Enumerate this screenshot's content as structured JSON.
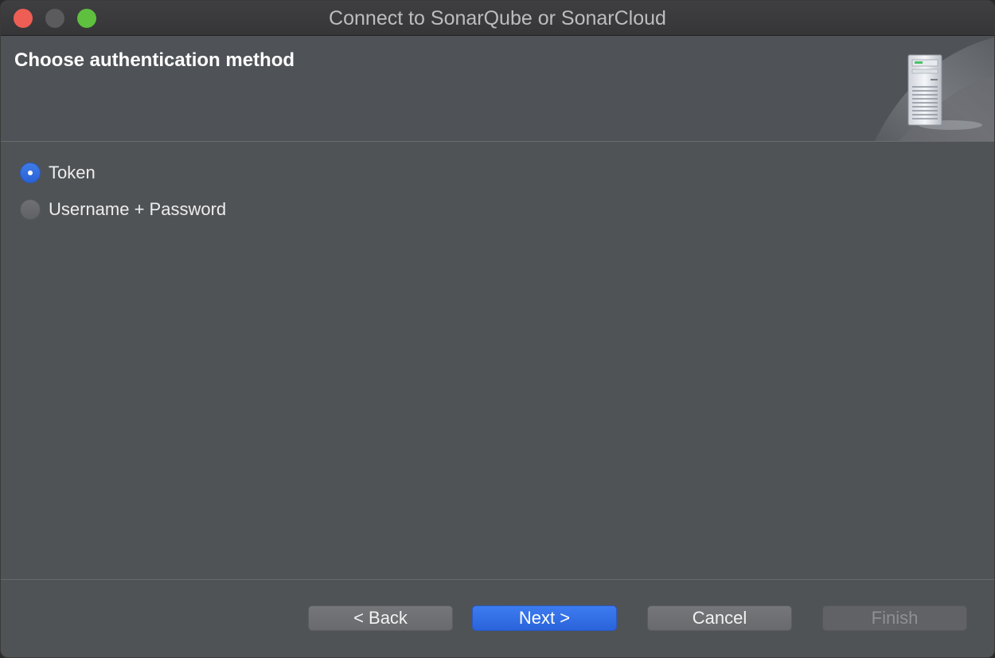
{
  "window": {
    "title": "Connect to SonarQube or SonarCloud"
  },
  "header": {
    "title": "Choose authentication method",
    "banner_icon": "server-icon"
  },
  "auth_options": [
    {
      "label": "Token",
      "selected": true
    },
    {
      "label": "Username + Password",
      "selected": false
    }
  ],
  "buttons": {
    "back": "< Back",
    "next": "Next >",
    "cancel": "Cancel",
    "finish": "Finish"
  },
  "colors": {
    "accent": "#2f6fe6",
    "close": "#ee5e55",
    "zoom": "#5fc03f"
  }
}
